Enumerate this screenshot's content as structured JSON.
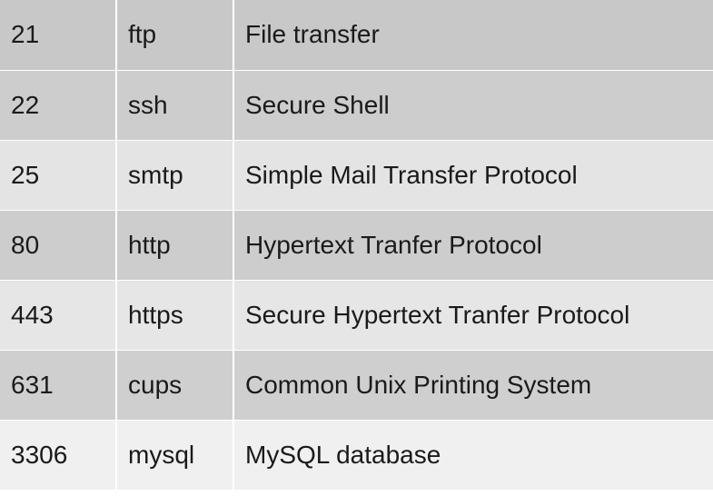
{
  "colors": {
    "row_odd": "#c8c8c8",
    "row_even": "#e6e6e6",
    "row_last": "#f2f2f2",
    "text": "#1a1a1a"
  },
  "table": {
    "rows": [
      {
        "port": "21",
        "service": "ftp",
        "description": "File transfer"
      },
      {
        "port": "22",
        "service": "ssh",
        "description": "Secure Shell"
      },
      {
        "port": "25",
        "service": "smtp",
        "description": "Simple Mail Transfer Protocol"
      },
      {
        "port": "80",
        "service": "http",
        "description": "Hypertext Tranfer Protocol"
      },
      {
        "port": "443",
        "service": "https",
        "description": "Secure Hypertext Tranfer Protocol"
      },
      {
        "port": "631",
        "service": "cups",
        "description": "Common Unix Printing System"
      },
      {
        "port": "3306",
        "service": "mysql",
        "description": "MySQL database"
      }
    ]
  }
}
